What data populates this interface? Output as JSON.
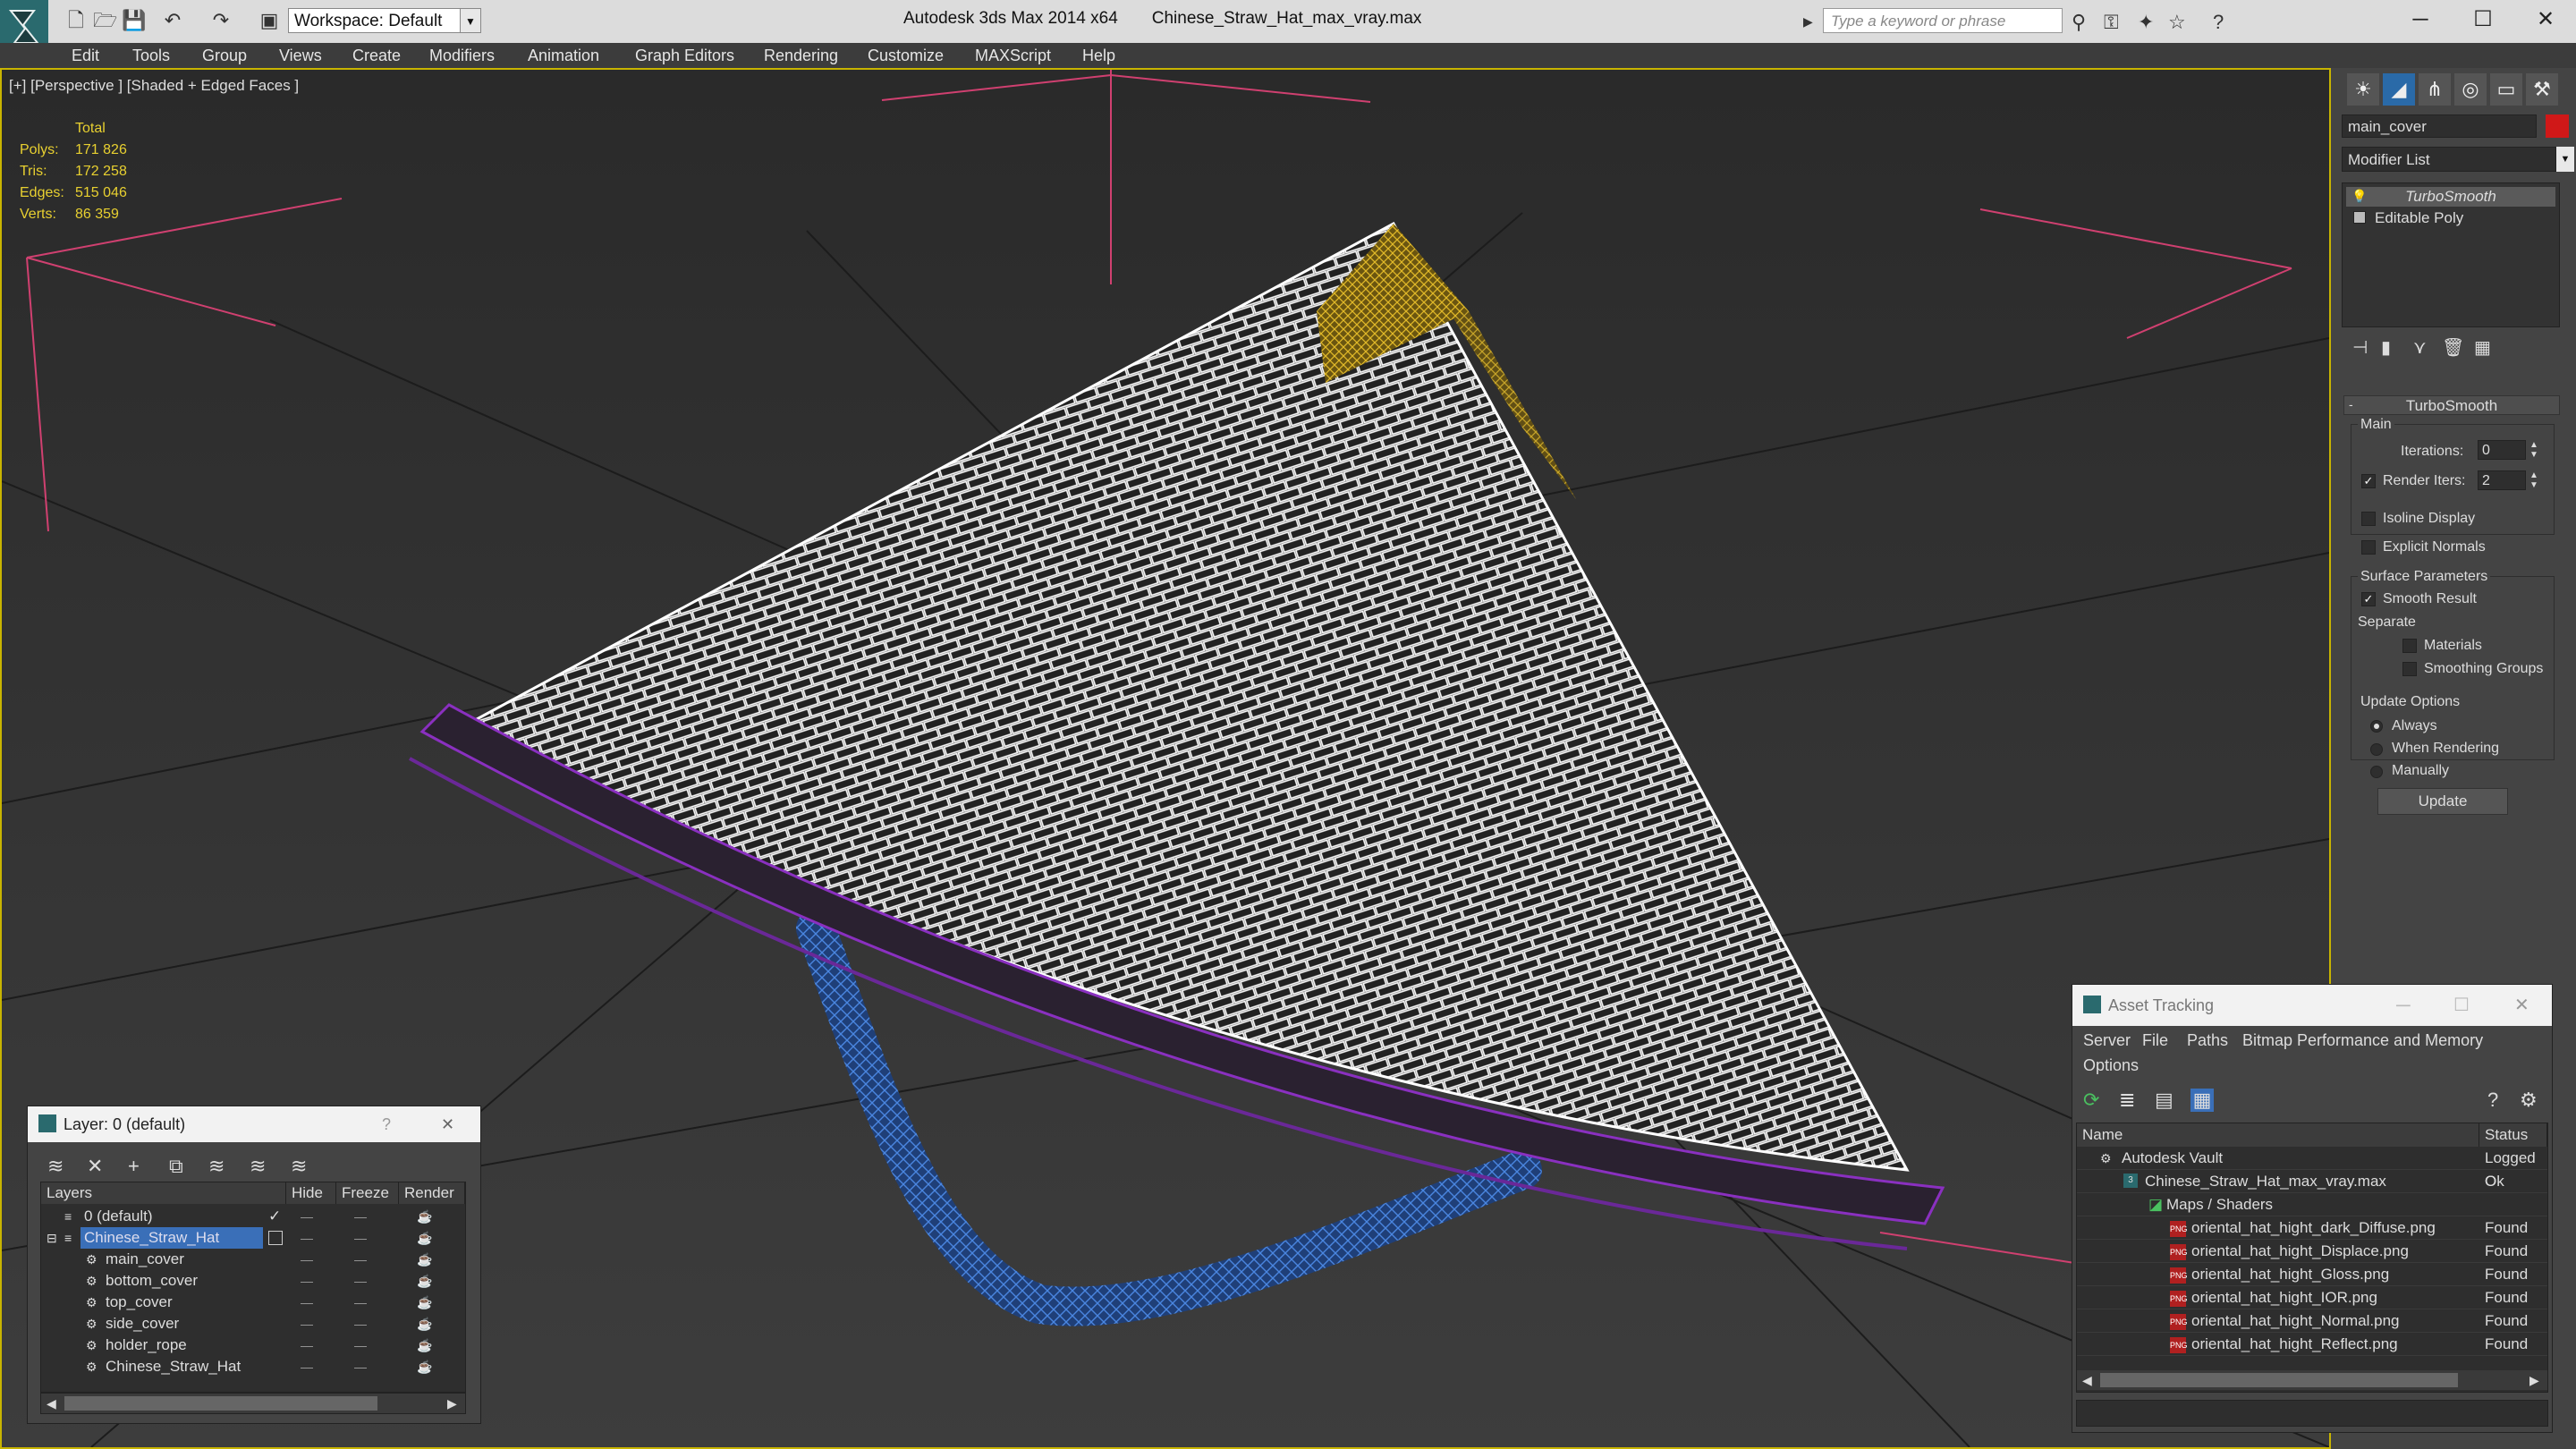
{
  "window": {
    "app_title": "Autodesk 3ds Max  2014 x64",
    "file_title": "Chinese_Straw_Hat_max_vray.max",
    "workspace": "Workspace: Default",
    "search_placeholder": "Type a keyword or phrase",
    "minimize": "─",
    "maximize": "☐",
    "close": "✕"
  },
  "menu": [
    "Edit",
    "Tools",
    "Group",
    "Views",
    "Create",
    "Modifiers",
    "Animation",
    "Graph Editors",
    "Rendering",
    "Customize",
    "MAXScript",
    "Help"
  ],
  "viewport": {
    "label": "[+] [Perspective ] [Shaded + Edged Faces ]",
    "stats": {
      "header": "Total",
      "rows": [
        {
          "label": "Polys:",
          "value": "171 826"
        },
        {
          "label": "Tris:",
          "value": "172 258"
        },
        {
          "label": "Edges:",
          "value": "515 046"
        },
        {
          "label": "Verts:",
          "value": "86 359"
        }
      ]
    }
  },
  "command_panel": {
    "object_name": "main_cover",
    "object_color": "#d01818",
    "modifier_list": "Modifier List",
    "stack": [
      "TurboSmooth",
      "Editable Poly"
    ],
    "rollout_title": "TurboSmooth",
    "main_group": "Main",
    "iterations_label": "Iterations:",
    "iterations_value": "0",
    "render_iters_label": "Render Iters:",
    "render_iters_value": "2",
    "isoline": "Isoline Display",
    "explicit_normals": "Explicit Normals",
    "surface_group": "Surface Parameters",
    "smooth_result": "Smooth Result",
    "separate": "Separate",
    "materials": "Materials",
    "smoothing_groups": "Smoothing Groups",
    "update_group": "Update Options",
    "always": "Always",
    "when_rendering": "When Rendering",
    "manually": "Manually",
    "update_button": "Update"
  },
  "layer_window": {
    "title": "Layer: 0 (default)",
    "help": "?",
    "close": "✕",
    "columns": [
      "Layers",
      "Hide",
      "Freeze",
      "Render"
    ],
    "rows": [
      {
        "name": "0 (default)",
        "indent": 1
      },
      {
        "name": "Chinese_Straw_Hat",
        "indent": 1
      },
      {
        "name": "main_cover",
        "indent": 2
      },
      {
        "name": "bottom_cover",
        "indent": 2
      },
      {
        "name": "top_cover",
        "indent": 2
      },
      {
        "name": "side_cover",
        "indent": 2
      },
      {
        "name": "holder_rope",
        "indent": 2
      },
      {
        "name": "Chinese_Straw_Hat",
        "indent": 2
      }
    ]
  },
  "asset_window": {
    "title": "Asset Tracking",
    "menu": [
      "Server",
      "File",
      "Paths",
      "Bitmap Performance and Memory"
    ],
    "menu2": "Options",
    "columns": [
      "Name",
      "Status"
    ],
    "rows": [
      {
        "name": "Autodesk Vault",
        "status": "Logged O",
        "indent": 1
      },
      {
        "name": "Chinese_Straw_Hat_max_vray.max",
        "status": "Ok",
        "indent": 2
      },
      {
        "name": "Maps / Shaders",
        "status": "",
        "indent": 3
      },
      {
        "name": "oriental_hat_hight_dark_Diffuse.png",
        "status": "Found",
        "indent": 4
      },
      {
        "name": "oriental_hat_hight_Displace.png",
        "status": "Found",
        "indent": 4
      },
      {
        "name": "oriental_hat_hight_Gloss.png",
        "status": "Found",
        "indent": 4
      },
      {
        "name": "oriental_hat_hight_IOR.png",
        "status": "Found",
        "indent": 4
      },
      {
        "name": "oriental_hat_hight_Normal.png",
        "status": "Found",
        "indent": 4
      },
      {
        "name": "oriental_hat_hight_Reflect.png",
        "status": "Found",
        "indent": 4
      }
    ]
  }
}
